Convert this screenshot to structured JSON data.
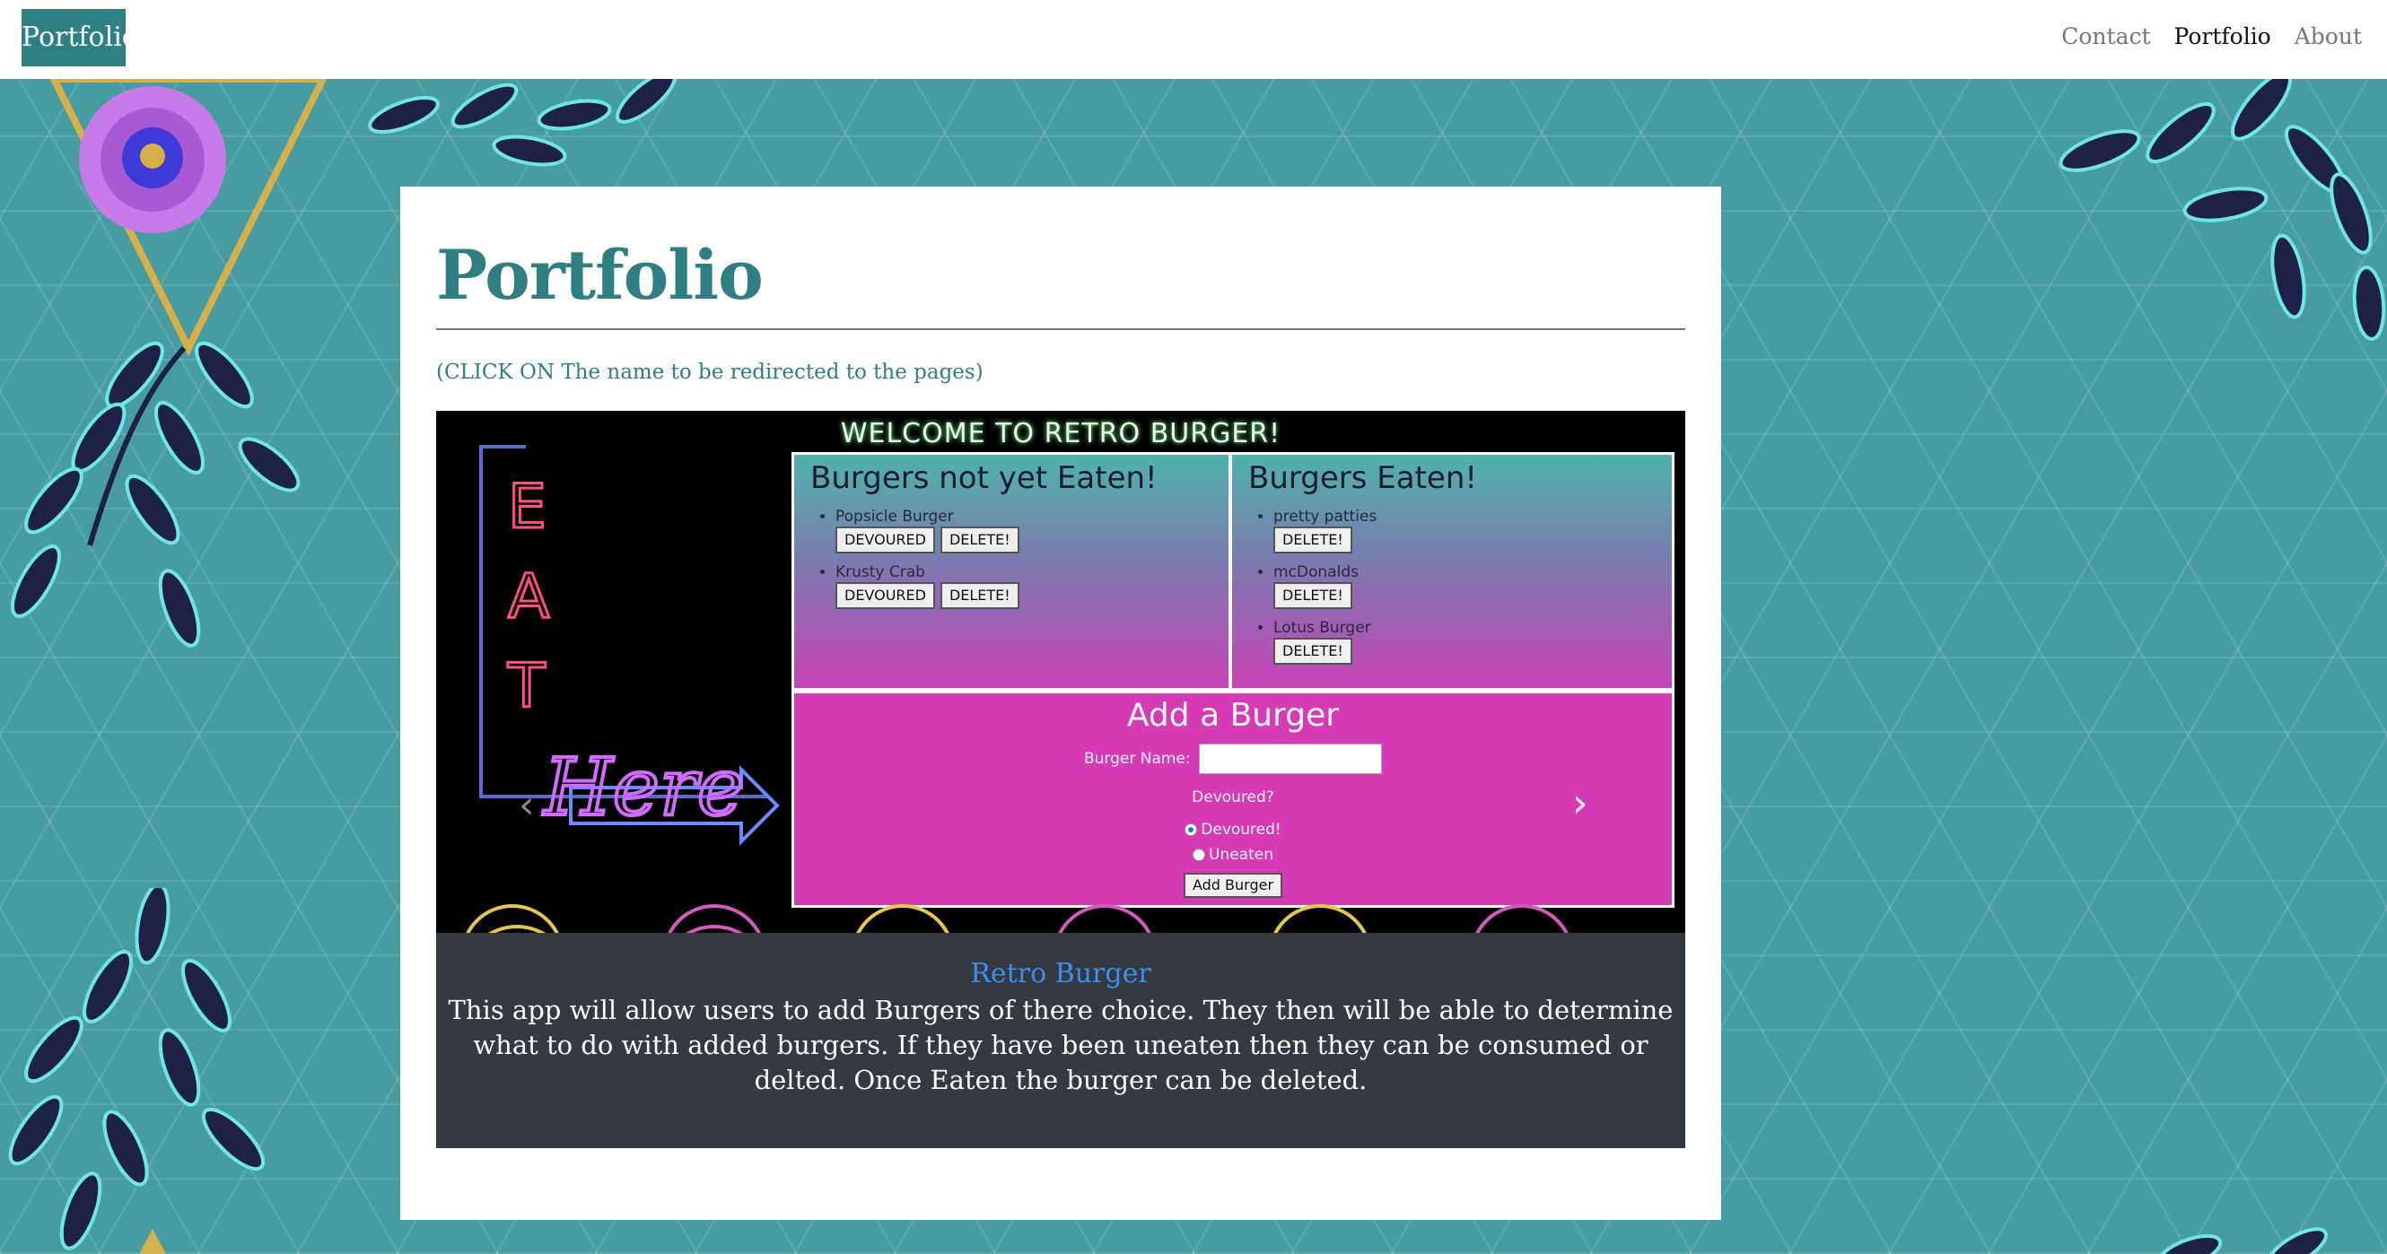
{
  "navbar": {
    "brand": "Portfolio",
    "links": [
      {
        "label": "Contact",
        "active": false
      },
      {
        "label": "Portfolio",
        "active": true
      },
      {
        "label": "About",
        "active": false
      }
    ]
  },
  "page": {
    "title": "Portfolio",
    "instructions": "(CLICK ON The name to be redirected to the pages)"
  },
  "slide": {
    "heading": "WELCOME TO RETRO BURGER!",
    "neon_sign": {
      "letters": [
        "E",
        "A",
        "T"
      ],
      "script": "Here"
    },
    "not_eaten": {
      "title": "Burgers not yet Eaten!",
      "items": [
        {
          "name": "Popsicle Burger",
          "devour_label": "DEVOURED",
          "delete_label": "DELETE!"
        },
        {
          "name": "Krusty Crab",
          "devour_label": "DEVOURED",
          "delete_label": "DELETE!"
        }
      ]
    },
    "eaten": {
      "title": "Burgers Eaten!",
      "items": [
        {
          "name": "pretty patties",
          "delete_label": "DELETE!"
        },
        {
          "name": "mcDonalds",
          "delete_label": "DELETE!"
        },
        {
          "name": "Lotus Burger",
          "delete_label": "DELETE!"
        }
      ]
    },
    "add_form": {
      "title": "Add a Burger",
      "name_label": "Burger Name:",
      "name_value": "",
      "devoured_question": "Devoured?",
      "option_devoured": "Devoured!",
      "option_uneaten": "Uneaten",
      "selected": "Devoured!",
      "submit_label": "Add Burger"
    }
  },
  "carousel": {
    "prev_icon": "chevron-left-icon",
    "next_icon": "chevron-right-icon"
  },
  "caption": {
    "title": "Retro Burger",
    "text": "This app will allow users to add Burgers of there choice. They then will be able to determine what to do with added burgers. If they have been uneaten then they can be consumed or delted. Once Eaten the burger can be deleted."
  },
  "colors": {
    "background": "#479ca2",
    "brand": "#2f8083",
    "title": "#2f7e82",
    "caption_bg": "#343a40",
    "caption_link": "#3b8ef0",
    "panel_pink": "#d63bb5",
    "leaf_navy": "#1e2147",
    "leaf_cyan": "#6fe6e6"
  }
}
